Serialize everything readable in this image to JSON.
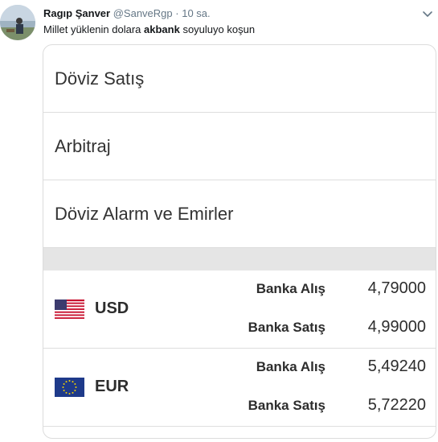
{
  "tweet": {
    "author_name": "Ragıp Şanver",
    "handle": "@SanveRgp",
    "separator": "·",
    "time": "10 sa.",
    "text_before": "Millet yüklenin dolara ",
    "text_bold": "akbank",
    "text_after": " soyuluyo koşun",
    "avatar_icon": "profile-photo",
    "menu_icon": "chevron-down-icon"
  },
  "screenshot": {
    "menu_items": [
      "Döviz Satış",
      "Arbitraj",
      "Döviz Alarm ve Emirler"
    ],
    "currencies": [
      {
        "code": "USD",
        "flag_icon": "us-flag-icon",
        "buy_label": "Banka Alış",
        "buy_value": "4,79000",
        "sell_label": "Banka Satış",
        "sell_value": "4,99000"
      },
      {
        "code": "EUR",
        "flag_icon": "eu-flag-icon",
        "buy_label": "Banka Alış",
        "buy_value": "5,49240",
        "sell_label": "Banka Satış",
        "sell_value": "5,72220"
      }
    ]
  },
  "colors": {
    "text": "#14171a",
    "muted": "#657786",
    "divider": "#dedede",
    "gap": "#e5e5e5"
  }
}
